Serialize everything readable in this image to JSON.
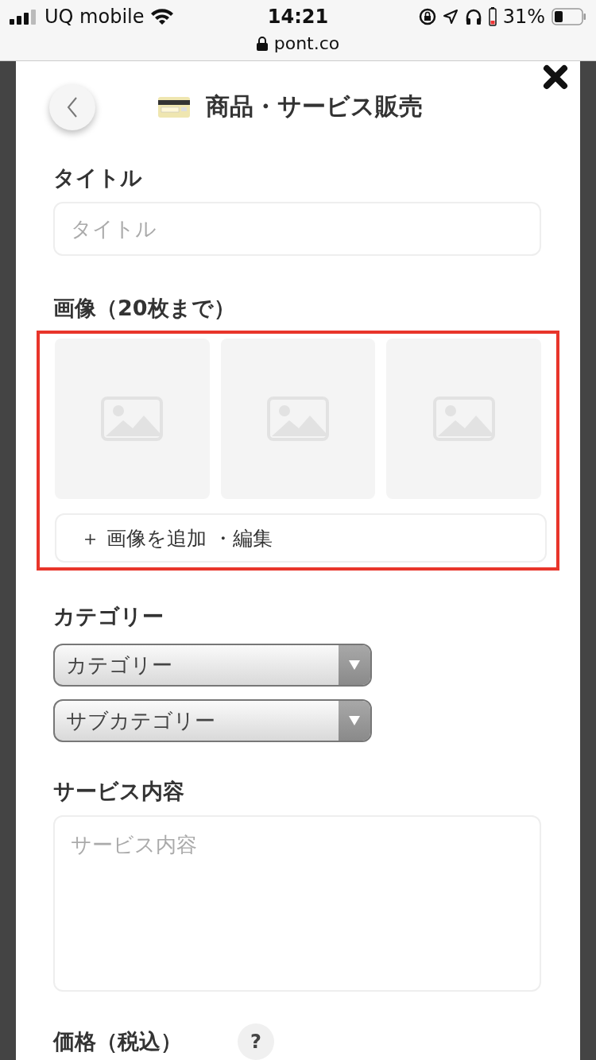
{
  "status_bar": {
    "carrier": "UQ mobile",
    "time": "14:21",
    "battery": "31%"
  },
  "browser": {
    "url": "pont.co"
  },
  "header": {
    "title": "商品・サービス販売"
  },
  "title_field": {
    "label": "タイトル",
    "placeholder": "タイトル"
  },
  "images": {
    "label": "画像（20枚まで）",
    "slots": [
      {
        "kind": "empty"
      },
      {
        "kind": "empty"
      },
      {
        "kind": "empty"
      }
    ],
    "add_button": "＋ 画像を追加 ・編集",
    "highlighted": true
  },
  "category": {
    "label": "カテゴリー",
    "selects": [
      {
        "value": "カテゴリー"
      },
      {
        "value": "サブカテゴリー"
      }
    ]
  },
  "description": {
    "label": "サービス内容",
    "placeholder": "サービス内容"
  },
  "price": {
    "label": "価格（税込）",
    "help": "?"
  }
}
